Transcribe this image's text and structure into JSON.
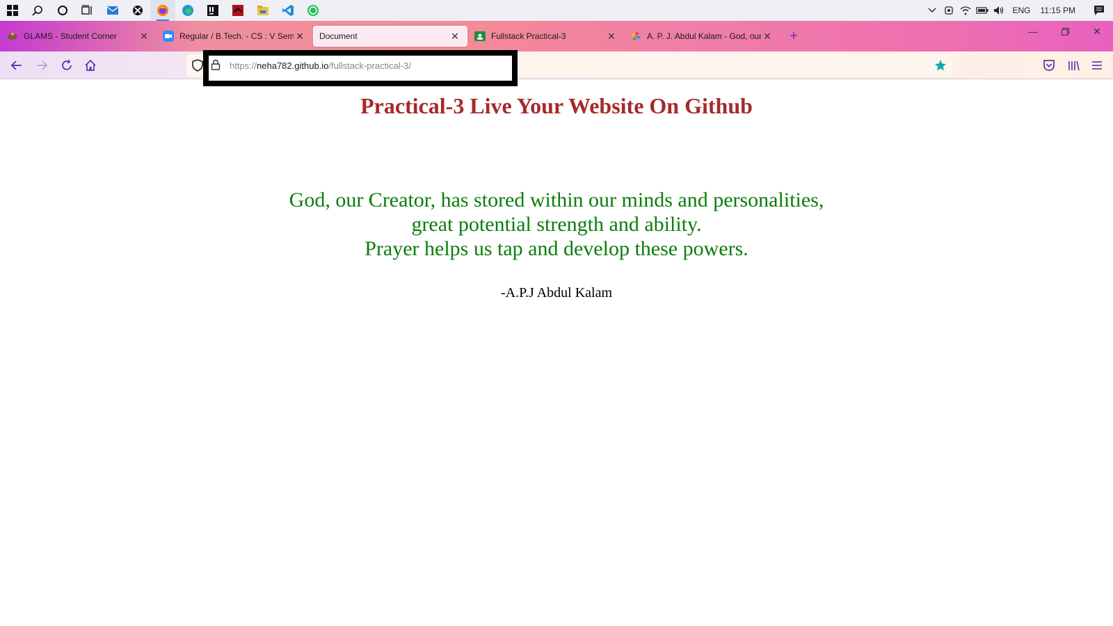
{
  "taskbar": {
    "apps": [
      {
        "name": "start-icon"
      },
      {
        "name": "search-icon"
      },
      {
        "name": "cortana-icon"
      },
      {
        "name": "task-view-icon"
      },
      {
        "name": "mail-icon"
      },
      {
        "name": "xbox-icon"
      },
      {
        "name": "firefox-icon"
      },
      {
        "name": "edge-icon"
      },
      {
        "name": "intellij-icon"
      },
      {
        "name": "app-red-icon"
      },
      {
        "name": "file-explorer-icon"
      },
      {
        "name": "vscode-icon"
      },
      {
        "name": "whatsapp-icon"
      }
    ],
    "tray": {
      "language": "ENG",
      "time": "11:15 PM"
    }
  },
  "tabs": [
    {
      "title": "GLAMS - Student Corner",
      "icon": "glams-icon",
      "selected": false
    },
    {
      "title": "Regular / B.Tech. - CS : V Sem /",
      "icon": "video-icon",
      "selected": false
    },
    {
      "title": "Document",
      "icon": "",
      "selected": true
    },
    {
      "title": "Fullstack Practical-3",
      "icon": "classroom-icon",
      "selected": false
    },
    {
      "title": "A. P. J. Abdul Kalam - God, our",
      "icon": "pinwheel-icon",
      "selected": false
    }
  ],
  "urlbar": {
    "scheme": "https://",
    "host": "neha782.github.io",
    "path": "/fullstack-practical-3/"
  },
  "page": {
    "title": "Practical-3 Live Your Website On Github",
    "quote_lines": [
      "God, our Creator, has stored within our minds and personalities,",
      "great potential strength and ability.",
      "Prayer helps us tap and develop these powers."
    ],
    "author": "-A.P.J Abdul Kalam"
  },
  "colors": {
    "title": "#a52a2a",
    "quote": "#0b7d0b",
    "bookmark_star": "#14a8a8"
  }
}
